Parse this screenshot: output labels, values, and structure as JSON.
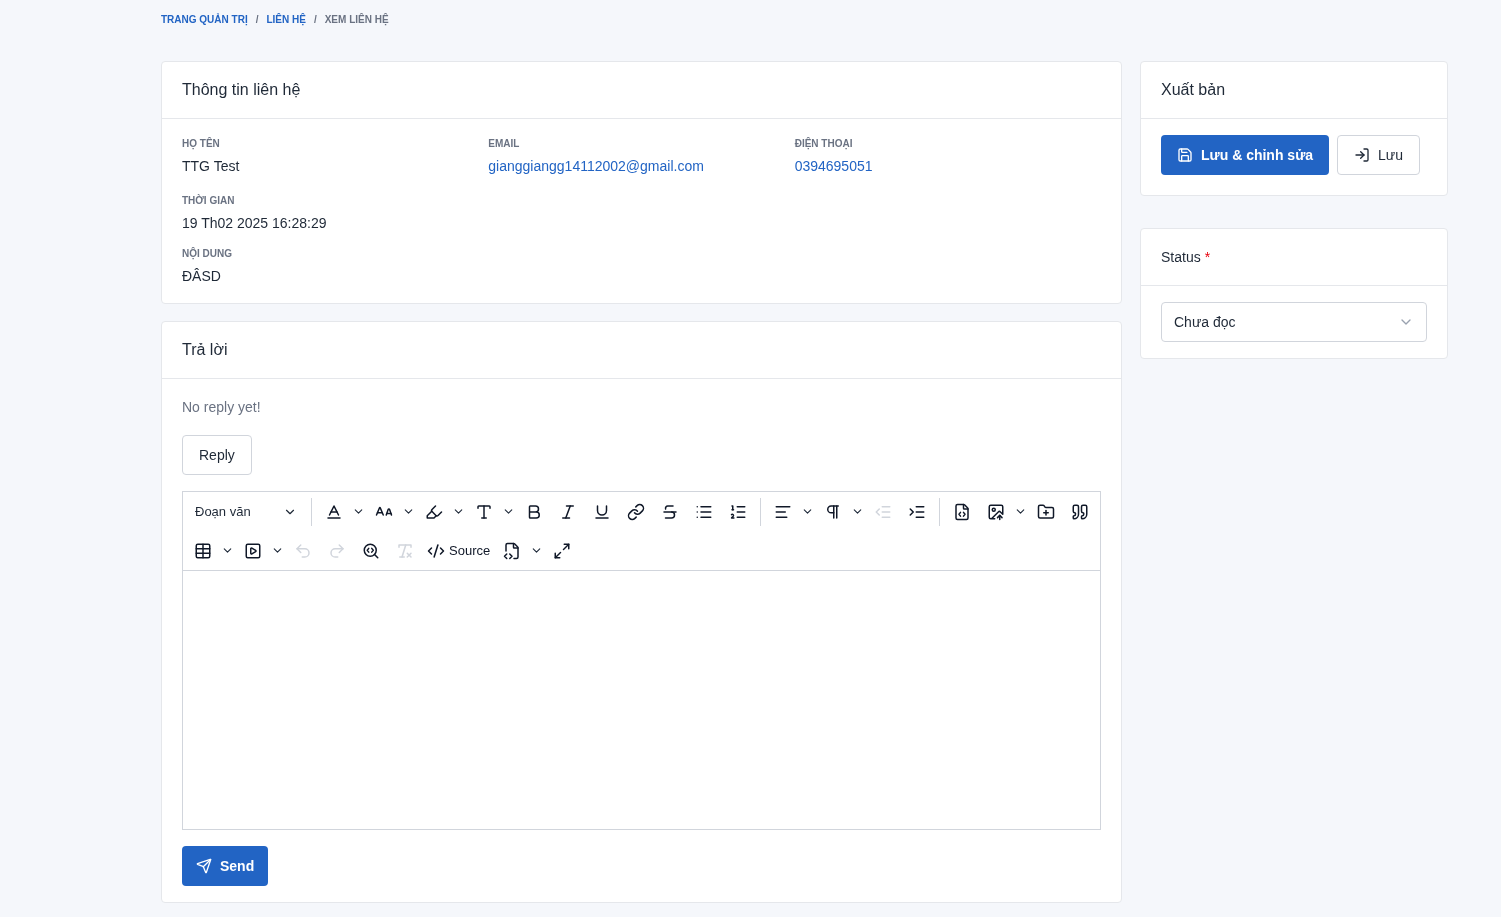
{
  "breadcrumb": [
    {
      "label": "TRANG QUẢN TRỊ",
      "current": false
    },
    {
      "label": "LIÊN HỆ",
      "current": false
    },
    {
      "label": "XEM LIÊN HỆ",
      "current": true
    }
  ],
  "breadcrumb_separator": "/",
  "contact_card": {
    "title": "Thông tin liên hệ",
    "fields": [
      {
        "label": "HỌ TÊN",
        "value": "TTG Test",
        "kind": "text"
      },
      {
        "label": "EMAIL",
        "value": "gianggiangg14112002@gmail.com",
        "kind": "link"
      },
      {
        "label": "ĐIỆN THOẠI",
        "value": "0394695051",
        "kind": "link"
      },
      {
        "label": "THỜI GIAN",
        "value": "19 Th02 2025 16:28:29",
        "kind": "text"
      },
      {
        "label": "NỘI DUNG",
        "value": "ĐÂSD",
        "kind": "text"
      }
    ]
  },
  "reply_card": {
    "title": "Trả lời",
    "empty_message": "No reply yet!",
    "reply_button": "Reply",
    "editor": {
      "paragraph_select": "Đoạn văn",
      "source_label": "Source",
      "toolbar": [
        {
          "kind": "separator"
        },
        {
          "kind": "button",
          "dropdown": true,
          "disabled": false
        },
        {
          "kind": "button",
          "dropdown": true,
          "disabled": false
        },
        {
          "kind": "button",
          "dropdown": true,
          "disabled": false
        },
        {
          "kind": "button",
          "dropdown": true,
          "disabled": false
        },
        {
          "kind": "button",
          "dropdown": false,
          "disabled": false
        },
        {
          "kind": "button",
          "dropdown": false,
          "disabled": false
        },
        {
          "kind": "button",
          "dropdown": false,
          "disabled": false
        },
        {
          "kind": "button",
          "dropdown": false,
          "disabled": false
        },
        {
          "kind": "button",
          "dropdown": false,
          "disabled": false
        },
        {
          "kind": "button",
          "dropdown": false,
          "disabled": false
        },
        {
          "kind": "button",
          "dropdown": false,
          "disabled": false
        },
        {
          "kind": "separator"
        },
        {
          "kind": "button",
          "dropdown": true,
          "disabled": false
        },
        {
          "kind": "button",
          "dropdown": true,
          "disabled": false
        },
        {
          "kind": "button",
          "dropdown": false,
          "disabled": true
        },
        {
          "kind": "button",
          "dropdown": false,
          "disabled": false
        },
        {
          "kind": "separator"
        },
        {
          "kind": "button",
          "dropdown": false,
          "disabled": false
        },
        {
          "kind": "button",
          "dropdown": true,
          "disabled": false
        },
        {
          "kind": "button",
          "dropdown": false,
          "disabled": false
        },
        {
          "kind": "button",
          "dropdown": false,
          "disabled": false
        },
        {
          "kind": "break"
        },
        {
          "kind": "button",
          "dropdown": true,
          "disabled": false
        },
        {
          "kind": "button",
          "dropdown": true,
          "disabled": false
        },
        {
          "kind": "button",
          "dropdown": false,
          "disabled": true
        },
        {
          "kind": "button",
          "dropdown": false,
          "disabled": true
        },
        {
          "kind": "button",
          "dropdown": false,
          "disabled": false
        },
        {
          "kind": "button",
          "dropdown": false,
          "disabled": true
        },
        {
          "kind": "source"
        },
        {
          "kind": "button",
          "dropdown": true,
          "disabled": false
        },
        {
          "kind": "button",
          "dropdown": false,
          "disabled": false
        }
      ]
    },
    "send_button": "Send"
  },
  "publish_card": {
    "title": "Xuất bản",
    "buttons": [
      {
        "label": "Lưu & chỉnh sửa",
        "kind": "primary"
      },
      {
        "label": "Lưu",
        "kind": "secondary"
      }
    ]
  },
  "status_card": {
    "title": "Status",
    "required_mark": "*",
    "select_value": "Chưa đọc"
  }
}
